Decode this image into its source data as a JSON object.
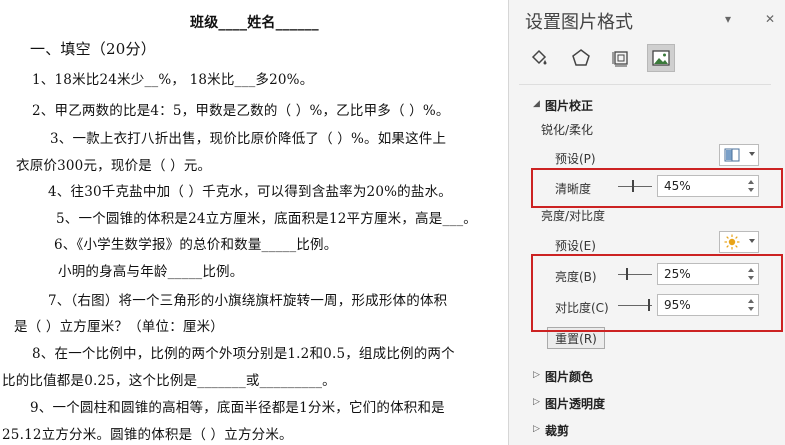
{
  "document": {
    "title": "班级____姓名______",
    "section1": "一、填空（20分）",
    "lines": [
      "1、18米比24米少__%，   18米比___多20%。",
      "2、甲乙两数的比是4：5，甲数是乙数的（  ）%，乙比甲多（  ）%。",
      "3、一款上衣打八折出售，现价比原价降低了（   ）%。如果这件上",
      "衣原价300元，现价是（    ）元。",
      "4、往30千克盐中加（   ）千克水，可以得到含盐率为20%的盐水。",
      "5、一个圆锥的体积是24立方厘米，底面积是12平方厘米，高是___。",
      "6、《小学生数学报》的总价和数量_____比例。",
      "小明的身高与年龄_____比例。",
      "7、（右图）将一个三角形的小旗绕旗杆旋转一周，形成形体的体积",
      "是（    ）立方厘米？（单位：厘米）",
      "8、在一个比例中，比例的两个外项分别是1.2和0.5，组成比例的两个",
      "比的比值都是0.25，这个比例是_______或_________。",
      "9、一个圆柱和圆锥的高相等，底面半径都是1分米，它们的体积和是",
      "25.12立方分米。圆锥的体积是（    ）立方分米。"
    ]
  },
  "pane": {
    "title": "设置图片格式",
    "dropdown_glyph": "▾",
    "close_glyph": "✕",
    "tabs": [
      "fill-line",
      "effects",
      "size-properties",
      "picture"
    ],
    "picture_correction": {
      "title": "图片校正",
      "sharpen_soften": {
        "title": "锐化/柔化",
        "preset_label": "预设(P)",
        "sharpness_label": "清晰度",
        "sharpness_value": "45%",
        "sharpness_level": 45
      },
      "brightness_contrast": {
        "title": "亮度/对比度",
        "preset_label": "预设(E)",
        "brightness_label": "亮度(B)",
        "brightness_value": "25%",
        "brightness_level": 25,
        "contrast_label": "对比度(C)",
        "contrast_value": "95%",
        "contrast_level": 95
      },
      "reset_label": "重置(R)"
    },
    "collapsed_sections": [
      "图片颜色",
      "图片透明度",
      "裁剪"
    ]
  },
  "colors": {
    "highlight_border": "#cc2222",
    "pane_background": "#f4f4f4"
  }
}
